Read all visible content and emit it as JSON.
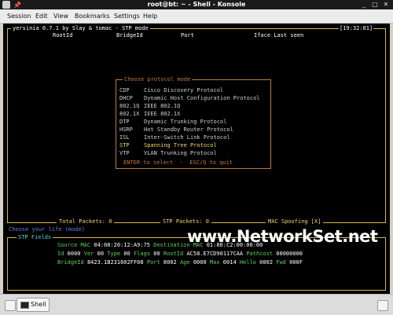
{
  "window": {
    "title": "root@bt: ~ - Shell - Konsole",
    "pin_glyph": "📌",
    "buttons": [
      "_",
      "□",
      "✕"
    ]
  },
  "menu": [
    "Session",
    "Edit",
    "View",
    "Bookmarks",
    "Settings",
    "Help"
  ],
  "terminal": {
    "app_title": "yersinia 0.7.1 by Slay & tomac - STP mode",
    "clock": "[19:32:01]",
    "columns": [
      "RootId",
      "BridgeId",
      "Port",
      "Iface Last seen"
    ],
    "status": {
      "total_packets": "Total Packets: 0",
      "stp_packets": "STP Packets: 0",
      "mac_spoofing": "MAC Spoofing [X]"
    },
    "prompt": "Choose your life (mode)",
    "fields": {
      "title": "STP Fields",
      "row1": [
        {
          "label": "Source MAC",
          "value": "04:08:20:12:A9:75"
        },
        {
          "label": "Destination MAC",
          "value": "01:80:C2:00:00:00"
        }
      ],
      "row2": [
        {
          "label": "Id",
          "value": "0000"
        },
        {
          "label": "Ver",
          "value": "00"
        },
        {
          "label": "Type",
          "value": "00"
        },
        {
          "label": "Flags",
          "value": "00"
        },
        {
          "label": "RootId",
          "value": "AC58.E7CD90117CAA"
        },
        {
          "label": "Pathcost",
          "value": "00000000"
        }
      ],
      "row3": [
        {
          "label": "BridgeId",
          "value": "8423.1B231602FF08"
        },
        {
          "label": "Port",
          "value": "8002"
        },
        {
          "label": "Age",
          "value": "0000"
        },
        {
          "label": "Max",
          "value": "0014"
        },
        {
          "label": "Hello",
          "value": "0002"
        },
        {
          "label": "Fwd",
          "value": "000F"
        }
      ]
    }
  },
  "dialog": {
    "title": "Choose protocol mode",
    "options": [
      {
        "code": "CDP",
        "name": "Cisco Discovery Protocol"
      },
      {
        "code": "DHCP",
        "name": "Dynamic Host Configuration Protocol"
      },
      {
        "code": "802.1Q",
        "name": "IEEE 802.1Q"
      },
      {
        "code": "802.1X",
        "name": "IEEE 802.1X"
      },
      {
        "code": "DTP",
        "name": "Dynamic Trunking Protocol"
      },
      {
        "code": "HSRP",
        "name": "Hot Standby Router Protocol"
      },
      {
        "code": "ISL",
        "name": "Inter-Switch Link Protocol"
      },
      {
        "code": "STP",
        "name": "Spanning Tree Protocol"
      },
      {
        "code": "VTP",
        "name": "VLAN Trunking Protocol"
      }
    ],
    "selected_code": "STP",
    "footer": "ENTER to select  -  ESC/Q to quit"
  },
  "watermark": "www.NetworkSet.net",
  "tabbar": {
    "tab_label": "Shell"
  }
}
